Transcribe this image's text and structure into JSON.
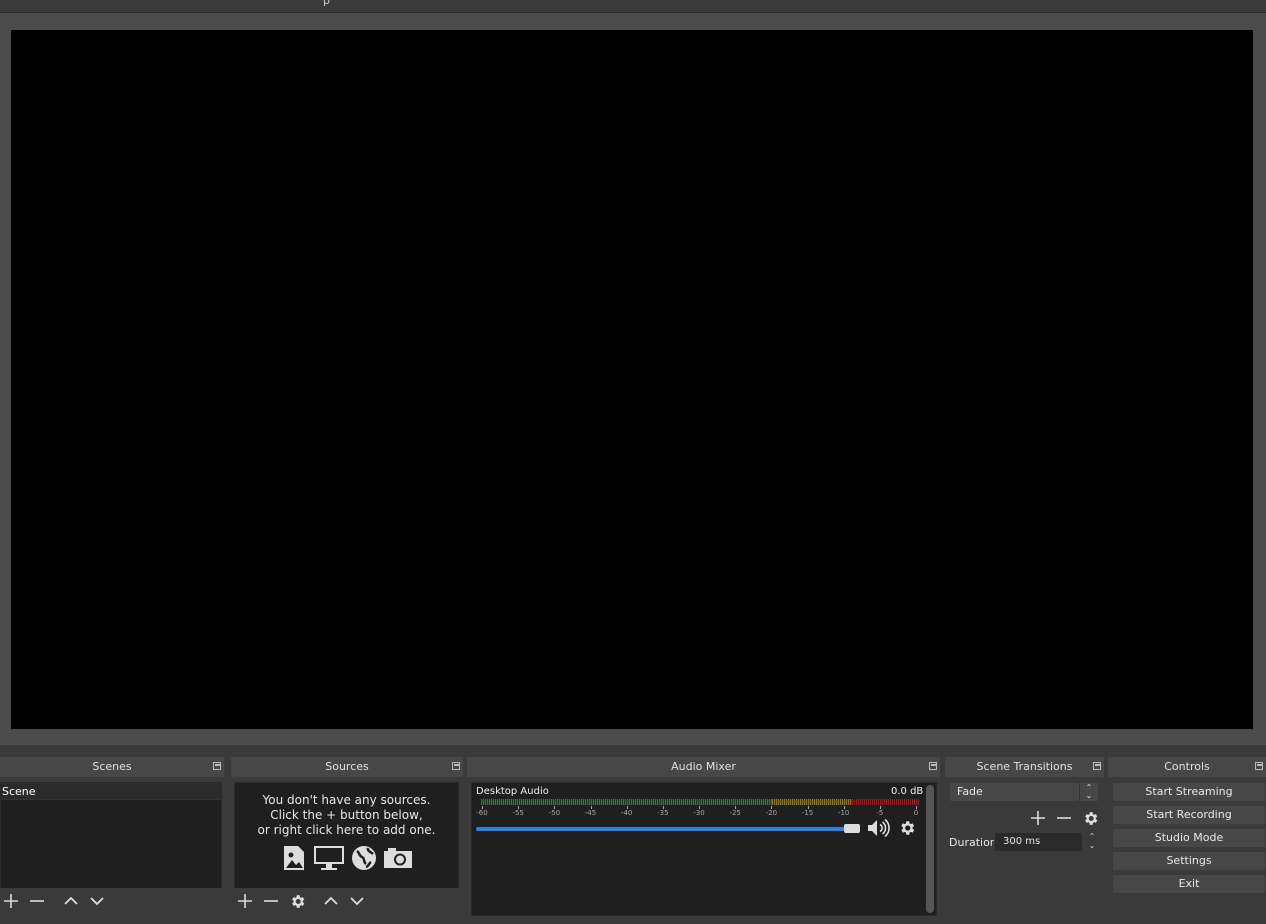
{
  "menubar": {
    "fragment": "p"
  },
  "docks": {
    "scenes": {
      "title": "Scenes",
      "items": [
        {
          "label": "Scene"
        }
      ]
    },
    "sources": {
      "title": "Sources",
      "empty_line1": "You don't have any sources.",
      "empty_line2": "Click the + button below,",
      "empty_line3": "or right click here to add one.",
      "icons": [
        "image-icon",
        "display-capture-icon",
        "browser-globe-icon",
        "camera-icon"
      ]
    },
    "mixer": {
      "title": "Audio Mixer",
      "channel": {
        "name": "Desktop Audio",
        "level": "0.0 dB",
        "volume_fraction": 1.0
      },
      "ticks": [
        "-60",
        "-55",
        "-50",
        "-45",
        "-40",
        "-35",
        "-30",
        "-25",
        "-20",
        "-15",
        "-10",
        "-5",
        "0"
      ]
    },
    "transitions": {
      "title": "Scene Transitions",
      "selected": "Fade",
      "duration_label": "Duration",
      "duration_value": "300 ms"
    },
    "controls": {
      "title": "Controls",
      "buttons": [
        "Start Streaming",
        "Start Recording",
        "Studio Mode",
        "Settings",
        "Exit"
      ]
    }
  },
  "colors": {
    "meter_green": "#2e7d2e",
    "meter_yellow": "#8a7a1e",
    "meter_red": "#8a2222",
    "slider_blue": "#2a82da"
  }
}
